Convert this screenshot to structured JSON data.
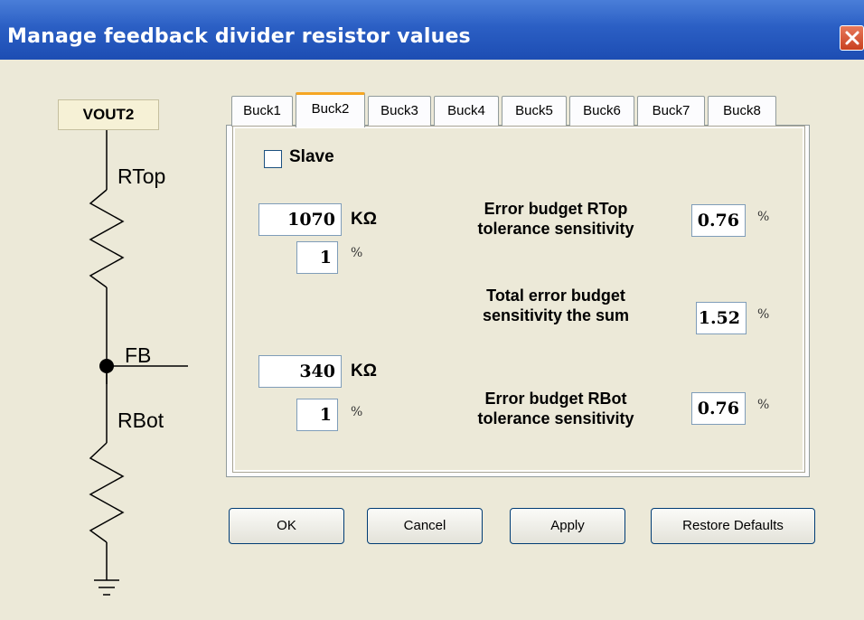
{
  "window": {
    "title": "Manage feedback divider resistor values",
    "close_icon": "close-icon"
  },
  "schematic": {
    "vout_label": "VOUT2",
    "rtop_label": "RTop",
    "fb_label": "FB",
    "rbot_label": "RBot"
  },
  "tabs": [
    {
      "label": "Buck1",
      "active": false
    },
    {
      "label": "Buck2",
      "active": true
    },
    {
      "label": "Buck3",
      "active": false
    },
    {
      "label": "Buck4",
      "active": false
    },
    {
      "label": "Buck5",
      "active": false
    },
    {
      "label": "Buck6",
      "active": false
    },
    {
      "label": "Buck7",
      "active": false
    },
    {
      "label": "Buck8",
      "active": false
    }
  ],
  "panel": {
    "slave_label": "Slave",
    "slave_checked": false,
    "rtop_value": "1070",
    "rtop_unit": "KΩ",
    "rtop_tol": "1",
    "rtop_tol_unit": "%",
    "rbot_value": "340",
    "rbot_unit": "KΩ",
    "rbot_tol": "1",
    "rbot_tol_unit": "%",
    "err_rtop_line1": "Error budget RTop",
    "err_rtop_line2": "tolerance sensitivity",
    "err_rtop_value": "0.76",
    "err_total_line1": "Total error budget",
    "err_total_line2": "sensitivity the sum",
    "err_total_value": "1.52",
    "err_rbot_line1": "Error budget RBot",
    "err_rbot_line2": "tolerance sensitivity",
    "err_rbot_value": "0.76",
    "pct_unit": "%"
  },
  "buttons": {
    "ok": "OK",
    "cancel": "Cancel",
    "apply": "Apply",
    "restore": "Restore Defaults"
  },
  "colors": {
    "titlebar": "#2b5fc4",
    "window_bg": "#ece9d8",
    "active_tab_accent": "#f5a623"
  }
}
